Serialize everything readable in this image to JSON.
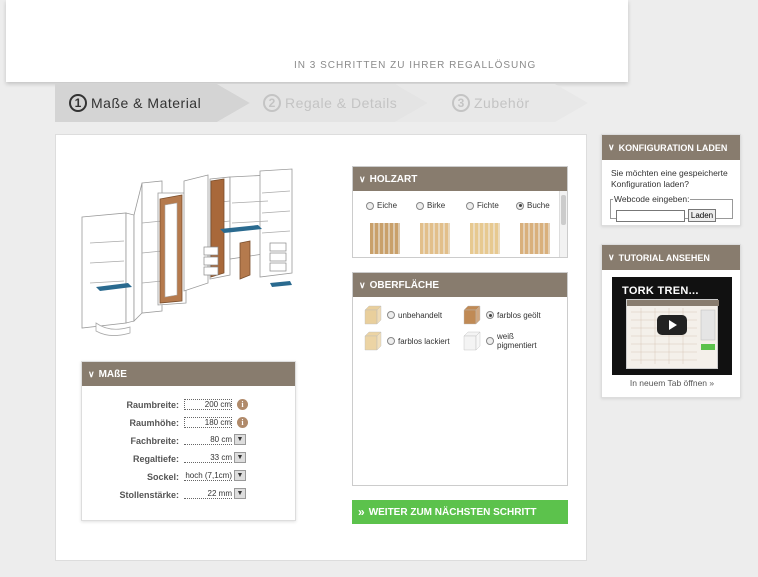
{
  "header": {
    "tagline": "IN 3 SCHRITTEN ZU IHRER REGALLÖSUNG"
  },
  "steps": [
    {
      "num": "1",
      "label": "Maße & Material",
      "state": "active"
    },
    {
      "num": "2",
      "label": "Regale & Details",
      "state": "inactive"
    },
    {
      "num": "3",
      "label": "Zubehör",
      "state": "inactive"
    }
  ],
  "masse": {
    "title": "MAßE",
    "rows": [
      {
        "label": "Raumbreite:",
        "value": "200 cm",
        "control": "info"
      },
      {
        "label": "Raumhöhe:",
        "value": "180 cm",
        "control": "info"
      },
      {
        "label": "Fachbreite:",
        "value": "80 cm",
        "control": "dropdown"
      },
      {
        "label": "Regaltiefe:",
        "value": "33 cm",
        "control": "dropdown"
      },
      {
        "label": "Sockel:",
        "value": "hoch (7,1cm)",
        "control": "dropdown"
      },
      {
        "label": "Stollenstärke:",
        "value": "22 mm",
        "control": "dropdown"
      }
    ]
  },
  "holzart": {
    "title": "HOLZART",
    "options": [
      {
        "label": "Eiche",
        "selected": false,
        "color": "#c9a06a"
      },
      {
        "label": "Birke",
        "selected": false,
        "color": "#e2bf8a"
      },
      {
        "label": "Fichte",
        "selected": false,
        "color": "#e7c990"
      },
      {
        "label": "Buche",
        "selected": true,
        "color": "#d9b07c"
      }
    ]
  },
  "oberflaeche": {
    "title": "OBERFLÄCHE",
    "options": [
      {
        "label": "unbehandelt",
        "selected": false,
        "color": "#e9cf9c"
      },
      {
        "label": "farblos geölt",
        "selected": true,
        "color": "#c08a55"
      },
      {
        "label": "farblos lackiert",
        "selected": false,
        "color": "#ecd4a4"
      },
      {
        "label": "weiß pigmentiert",
        "selected": false,
        "color": "#f4f4f4"
      }
    ]
  },
  "next_button": "WEITER ZUM NÄCHSTEN SCHRITT",
  "konfig": {
    "title": "KONFIGURATION LADEN",
    "text": "Sie möchten eine gespeicherte Konfiguration laden?",
    "legend": "Webcode eingeben:",
    "input_value": "",
    "button": "Laden"
  },
  "tutorial": {
    "title": "TUTORIAL ANSEHEN",
    "video_title": "TORK TREN...",
    "link": "In neuem Tab öffnen »"
  },
  "colors": {
    "panel_head": "#887c6e",
    "next_button": "#5cc24c",
    "accent_blue": "#2a6a8f"
  }
}
